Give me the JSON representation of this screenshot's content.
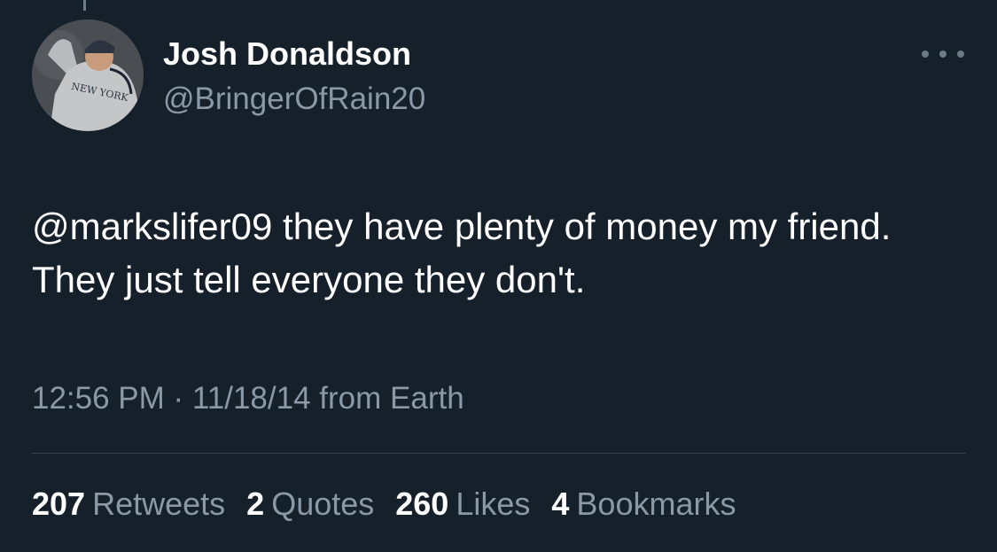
{
  "tweet": {
    "author": {
      "name": "Josh Donaldson",
      "handle": "@BringerOfRain20",
      "avatar_jersey_text": "NEW YORK"
    },
    "text": {
      "mention": "@markslifer09",
      "rest": " they have plenty of money my friend. They just tell everyone they don't."
    },
    "meta": "12:56 PM · 11/18/14 from Earth",
    "stats": [
      {
        "count": "207",
        "label": "Retweets"
      },
      {
        "count": "2",
        "label": "Quotes"
      },
      {
        "count": "260",
        "label": "Likes"
      },
      {
        "count": "4",
        "label": "Bookmarks"
      }
    ]
  },
  "colors": {
    "background": "#15202b",
    "primary_text": "#ffffff",
    "secondary_text": "#8b98a5",
    "divider": "#38444d"
  },
  "icons": {
    "more": "more-horizontal-icon"
  }
}
